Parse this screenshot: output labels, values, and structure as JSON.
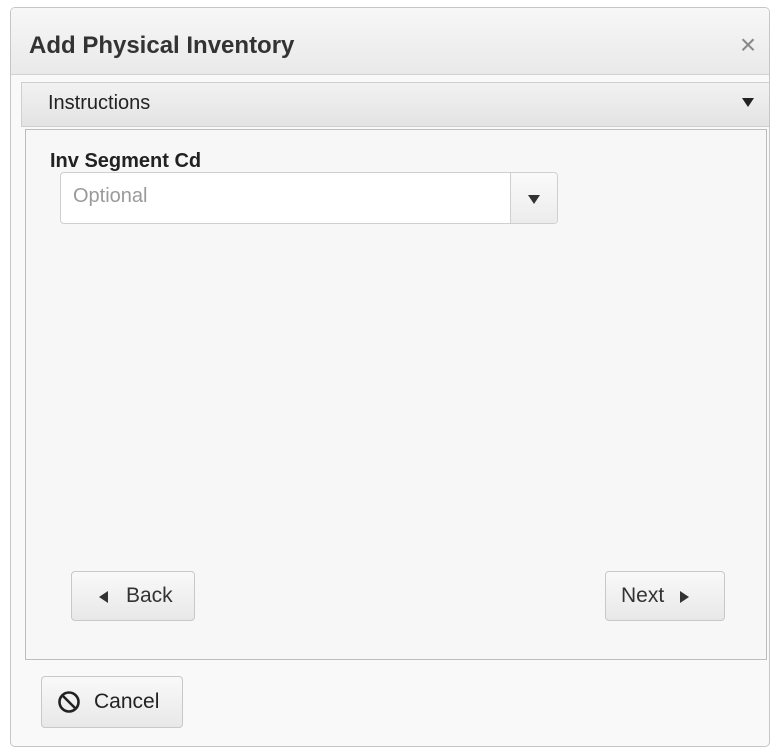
{
  "dialog": {
    "title": "Add Physical Inventory",
    "close_icon": "×"
  },
  "instructions": {
    "label": "Instructions",
    "toggle_icon": "caret-down-icon"
  },
  "form": {
    "field_label": "Inv Segment Cd",
    "select_placeholder": "Optional",
    "select_icon": "caret-down-icon"
  },
  "nav": {
    "back_label": "Back",
    "next_label": "Next",
    "back_icon": "triangle-left-icon",
    "next_icon": "triangle-right-icon"
  },
  "footer": {
    "cancel_label": "Cancel",
    "cancel_icon": "prohibited-icon"
  }
}
